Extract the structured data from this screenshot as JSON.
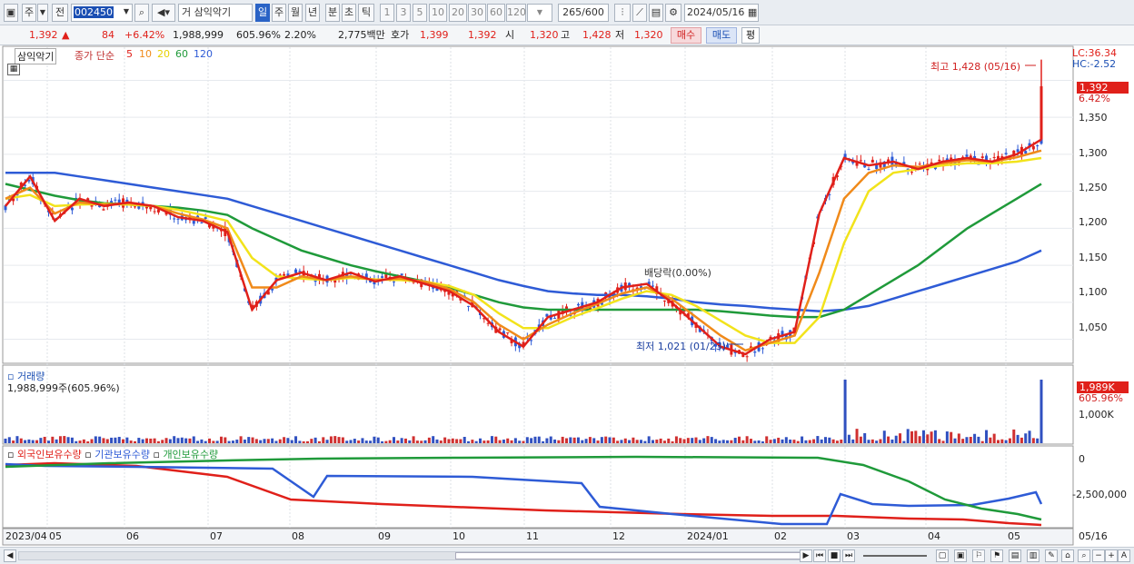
{
  "toolbar": {
    "market": "주",
    "prev": "전",
    "code": "002450",
    "name": "삼익악기",
    "name_prefix": "거",
    "periods": [
      "일",
      "주",
      "월",
      "년",
      "분",
      "초",
      "틱"
    ],
    "active_period": "일",
    "intervals": [
      "1",
      "3",
      "5",
      "10",
      "20",
      "30",
      "60",
      "120"
    ],
    "count": "265",
    "total": "/600",
    "date": "2024/05/16"
  },
  "quote": {
    "price": "1,392",
    "arrow": "▲",
    "change": "84",
    "pct": "+6.42%",
    "volume": "1,988,999",
    "vol_ratio": "605.96%",
    "turnover": "2.20%",
    "amount": "2,775백만",
    "bid_label": "호가",
    "ask": "1,399",
    "bid": "1,392",
    "open_label": "시",
    "open": "1,320",
    "high_label": "고",
    "high": "1,428",
    "low_label": "저",
    "low": "1,320",
    "buy": "매수",
    "sell": "매도",
    "avg": "평"
  },
  "price_panel": {
    "label": "삼익악기",
    "ma_label": "종가 단순",
    "ma_periods": [
      "5",
      "10",
      "20",
      "60",
      "120"
    ],
    "ma_colors": [
      "#e0201a",
      "#f08a1a",
      "#f2e31b",
      "#1f9a3a",
      "#2e5bd6"
    ],
    "lc": "LC:36.34",
    "hc": "HC:-2.52",
    "high_note": "최고 1,428 (05/16)",
    "low_note": "최저 1,021 (01/23)",
    "dividend": "배당락(0.00%)",
    "last_price": "1,392",
    "last_pct": "6.42%",
    "y_ticks": [
      "1,400",
      "1,350",
      "1,300",
      "1,250",
      "1,200",
      "1,150",
      "1,100",
      "1,050"
    ]
  },
  "volume_panel": {
    "label": "거래량",
    "value": "1,988,999주(605.96%)",
    "badge": "1,989K",
    "badge_pct": "605.96%",
    "tick": "1,000K"
  },
  "holding_panel": {
    "foreign": "외국인보유수량",
    "inst": "기관보유수량",
    "indiv": "개인보유수량",
    "ticks": [
      "0",
      "-2,500,000"
    ]
  },
  "x_axis": {
    "labels": [
      "2023/04",
      "05",
      "06",
      "07",
      "08",
      "09",
      "10",
      "11",
      "12",
      "2024/01",
      "02",
      "03",
      "04",
      "05",
      "05/16"
    ]
  },
  "chart_data": {
    "type": "candlestick",
    "title": "삼익악기",
    "last_close": 1392,
    "high": {
      "value": 1428,
      "date": "05/16"
    },
    "low": {
      "value": 1021,
      "date": "01/23"
    },
    "ylim": [
      1020,
      1430
    ],
    "ma": [
      {
        "name": "5",
        "color": "#e0201a",
        "values": [
          1230,
          1270,
          1210,
          1240,
          1230,
          1235,
          1230,
          1215,
          1210,
          1195,
          1090,
          1130,
          1140,
          1130,
          1140,
          1128,
          1135,
          1125,
          1115,
          1095,
          1060,
          1040,
          1080,
          1090,
          1100,
          1120,
          1125,
          1100,
          1070,
          1040,
          1030,
          1050,
          1060,
          1220,
          1295,
          1285,
          1290,
          1280,
          1290,
          1295,
          1290,
          1300,
          1320
        ]
      },
      {
        "name": "10",
        "color": "#f08a1a",
        "values": [
          1240,
          1255,
          1220,
          1235,
          1232,
          1234,
          1230,
          1220,
          1212,
          1200,
          1120,
          1120,
          1135,
          1130,
          1135,
          1130,
          1132,
          1128,
          1118,
          1100,
          1070,
          1050,
          1070,
          1085,
          1098,
          1112,
          1120,
          1105,
          1080,
          1055,
          1035,
          1045,
          1055,
          1140,
          1240,
          1275,
          1285,
          1283,
          1288,
          1292,
          1290,
          1296,
          1305
        ]
      },
      {
        "name": "20",
        "color": "#f2e31b",
        "values": [
          1240,
          1245,
          1230,
          1232,
          1233,
          1232,
          1230,
          1225,
          1218,
          1210,
          1160,
          1135,
          1132,
          1130,
          1133,
          1131,
          1130,
          1128,
          1122,
          1110,
          1085,
          1065,
          1065,
          1080,
          1092,
          1105,
          1115,
          1110,
          1095,
          1075,
          1055,
          1045,
          1045,
          1080,
          1180,
          1250,
          1275,
          1280,
          1285,
          1288,
          1288,
          1290,
          1295
        ]
      },
      {
        "name": "60",
        "color": "#1f9a3a",
        "values": [
          1260,
          1252,
          1244,
          1238,
          1234,
          1232,
          1230,
          1228,
          1224,
          1218,
          1200,
          1185,
          1170,
          1160,
          1150,
          1142,
          1135,
          1128,
          1120,
          1110,
          1100,
          1093,
          1090,
          1090,
          1090,
          1090,
          1090,
          1090,
          1090,
          1088,
          1085,
          1082,
          1080,
          1080,
          1090,
          1110,
          1130,
          1150,
          1175,
          1200,
          1220,
          1240,
          1260
        ]
      },
      {
        "name": "120",
        "color": "#2e5bd6",
        "values": [
          1275,
          1275,
          1275,
          1270,
          1265,
          1260,
          1255,
          1250,
          1245,
          1240,
          1230,
          1220,
          1210,
          1200,
          1190,
          1180,
          1170,
          1160,
          1150,
          1140,
          1130,
          1122,
          1115,
          1112,
          1110,
          1110,
          1108,
          1105,
          1100,
          1097,
          1095,
          1092,
          1090,
          1088,
          1090,
          1095,
          1105,
          1115,
          1125,
          1135,
          1145,
          1155,
          1170
        ]
      }
    ]
  }
}
